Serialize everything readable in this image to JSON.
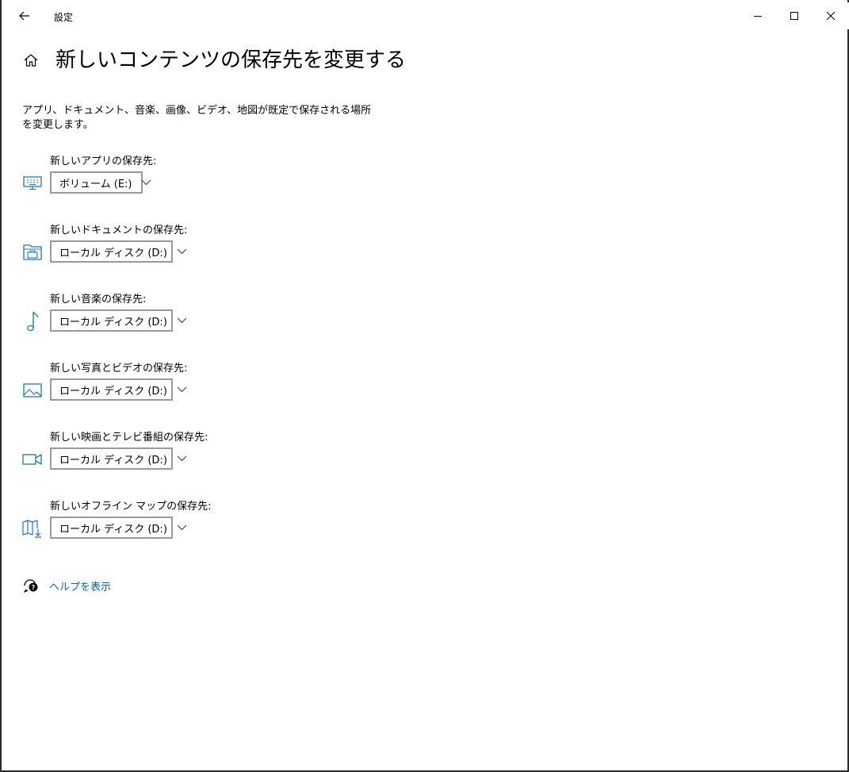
{
  "window": {
    "title": "設定"
  },
  "page": {
    "title": "新しいコンテンツの保存先を変更する",
    "description": "アプリ、ドキュメント、音楽、画像、ビデオ、地図が既定で保存される場所を変更します。"
  },
  "settings": [
    {
      "label": "新しいアプリの保存先:",
      "value": "ボリューム (E:)",
      "icon": "monitor-icon"
    },
    {
      "label": "新しいドキュメントの保存先:",
      "value": "ローカル ディスク (D:)",
      "icon": "folder-documents-icon"
    },
    {
      "label": "新しい音楽の保存先:",
      "value": "ローカル ディスク (D:)",
      "icon": "music-note-icon"
    },
    {
      "label": "新しい写真とビデオの保存先:",
      "value": "ローカル ディスク (D:)",
      "icon": "photo-icon"
    },
    {
      "label": "新しい映画とテレビ番組の保存先:",
      "value": "ローカル ディスク (D:)",
      "icon": "video-camera-icon"
    },
    {
      "label": "新しいオフライン マップの保存先:",
      "value": "ローカル ディスク (D:)",
      "icon": "map-download-icon"
    }
  ],
  "help": {
    "label": "ヘルプを表示",
    "icon": "help-chat-icon"
  },
  "colors": {
    "accent": "#0067b8",
    "icon_blue": "#1979ca",
    "dropdown_border": "#999999"
  }
}
